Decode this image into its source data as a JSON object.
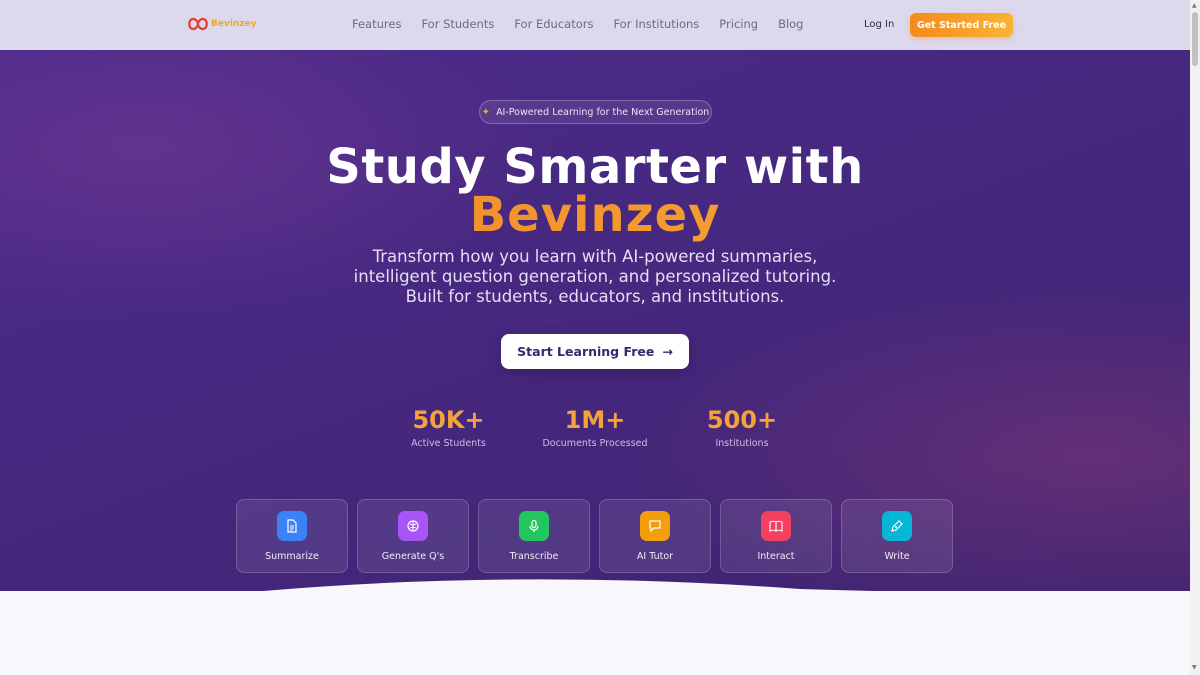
{
  "header": {
    "logo_text": "Bevinzey",
    "nav": [
      "Features",
      "For Students",
      "For Educators",
      "For Institutions",
      "Pricing",
      "Blog"
    ],
    "login_label": "Log In",
    "cta_label": "Get Started Free"
  },
  "hero": {
    "badge": "AI-Powered Learning for the Next Generation",
    "title_line1": "Study Smarter with",
    "title_line2": "Bevinzey",
    "subtitle": "Transform how you learn with AI-powered summaries, intelligent question generation, and personalized tutoring. Built for students, educators, and institutions.",
    "button_label": "Start Learning Free",
    "stats": [
      {
        "value": "50K+",
        "label": "Active Students"
      },
      {
        "value": "1M+",
        "label": "Documents Processed"
      },
      {
        "value": "500+",
        "label": "Institutions"
      }
    ],
    "features": [
      {
        "label": "Summarize",
        "icon": "document-icon",
        "color": "#3b82f6"
      },
      {
        "label": "Generate Q's",
        "icon": "brain-icon",
        "color": "#a855f7"
      },
      {
        "label": "Transcribe",
        "icon": "microphone-icon",
        "color": "#22c55e"
      },
      {
        "label": "AI Tutor",
        "icon": "chat-icon",
        "color": "#f59e0b"
      },
      {
        "label": "Interact",
        "icon": "book-icon",
        "color": "#f43f5e"
      },
      {
        "label": "Write",
        "icon": "pen-icon",
        "color": "#06b6d4"
      }
    ]
  },
  "colors": {
    "accent": "#f5a623",
    "hero_bg": "#46287f"
  }
}
